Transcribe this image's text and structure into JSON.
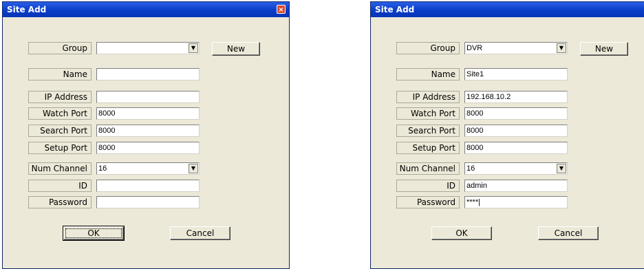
{
  "dialogs": [
    {
      "title": "Site Add",
      "close_label": "×",
      "group": {
        "label": "Group",
        "value": "",
        "new_label": "New"
      },
      "name": {
        "label": "Name",
        "value": ""
      },
      "ip": {
        "label": "IP Address",
        "value": ""
      },
      "watch": {
        "label": "Watch Port",
        "value": "8000"
      },
      "search": {
        "label": "Search Port",
        "value": "8000"
      },
      "setup": {
        "label": "Setup Port",
        "value": "8000"
      },
      "num_channel": {
        "label": "Num Channel",
        "value": "16"
      },
      "id": {
        "label": "ID",
        "value": ""
      },
      "password": {
        "label": "Password",
        "value": ""
      },
      "ok_label": "OK",
      "cancel_label": "Cancel",
      "dropdown_arrow": "▼"
    },
    {
      "title": "Site Add",
      "close_label": "×",
      "group": {
        "label": "Group",
        "value": "DVR",
        "new_label": "New"
      },
      "name": {
        "label": "Name",
        "value": "Site1"
      },
      "ip": {
        "label": "IP Address",
        "value": "192.168.10.2"
      },
      "watch": {
        "label": "Watch Port",
        "value": "8000"
      },
      "search": {
        "label": "Search Port",
        "value": "8000"
      },
      "setup": {
        "label": "Setup Port",
        "value": "8000"
      },
      "num_channel": {
        "label": "Num Channel",
        "value": "16"
      },
      "id": {
        "label": "ID",
        "value": "admin"
      },
      "password": {
        "label": "Password",
        "value": "****|"
      },
      "ok_label": "OK",
      "cancel_label": "Cancel",
      "dropdown_arrow": "▼"
    }
  ]
}
